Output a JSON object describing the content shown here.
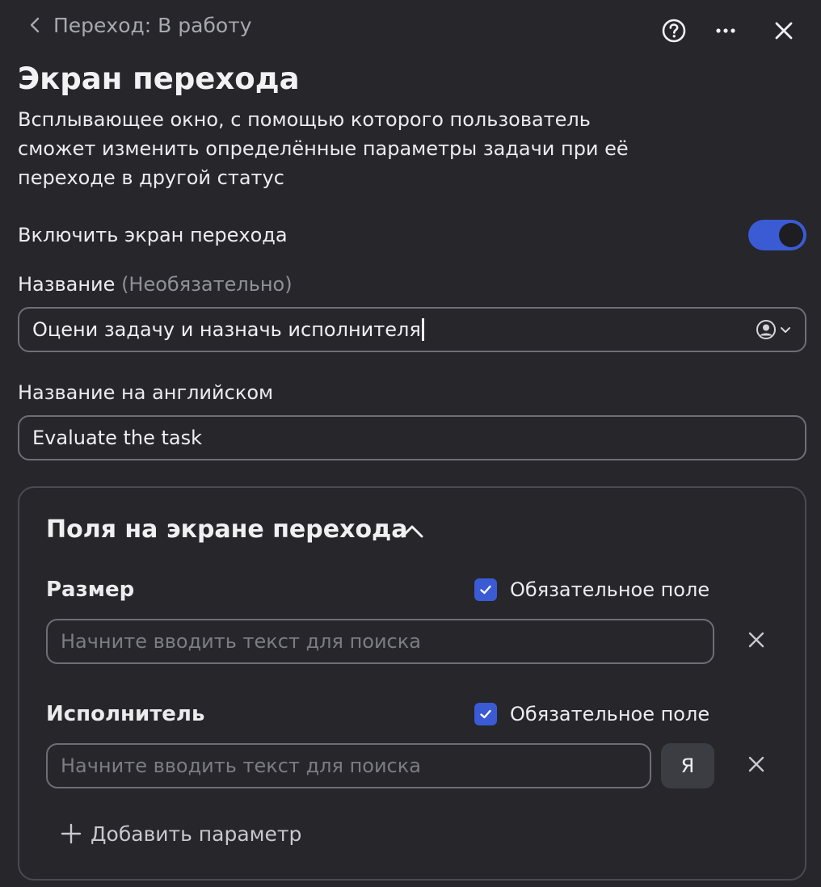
{
  "header": {
    "back_label": "Переход: В работу",
    "help_icon": "help-circle-icon",
    "more_icon": "more-horizontal-icon",
    "close_icon": "close-icon"
  },
  "page": {
    "title": "Экран перехода",
    "description": "Всплывающее окно, с помощью которого пользователь сможет изменить определённые параметры задачи при её переходе в другой статус"
  },
  "toggle": {
    "label": "Включить экран перехода",
    "enabled": true
  },
  "name_field": {
    "label": "Название",
    "optional": "(Необязательно)",
    "value": "Оцени задачу и назначь исполнителя"
  },
  "english_name_field": {
    "label": "Название на английском",
    "value": "Evaluate the task"
  },
  "fields_section": {
    "title": "Поля на экране перехода",
    "expanded": true,
    "fields": [
      {
        "name": "Размер",
        "required_label": "Обязательное поле",
        "required": true,
        "placeholder": "Начните вводить текст для поиска"
      },
      {
        "name": "Исполнитель",
        "required_label": "Обязательное поле",
        "required": true,
        "placeholder": "Начните вводить текст для поиска",
        "me_button": "Я"
      }
    ],
    "add_label": "Добавить параметр"
  },
  "colors": {
    "background": "#26262b",
    "accent": "#3a5bd4",
    "border": "#6e6e76",
    "muted_text": "#909098"
  }
}
